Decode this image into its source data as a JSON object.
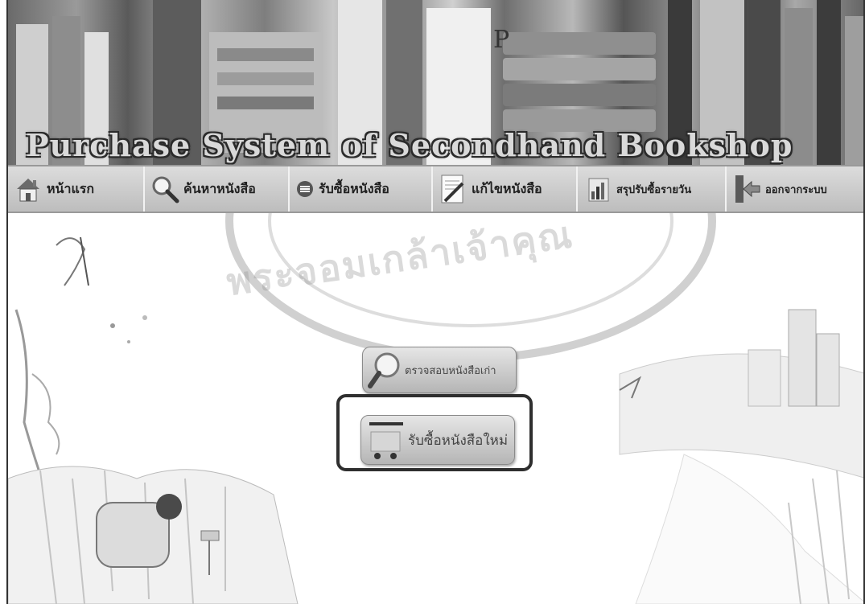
{
  "banner": {
    "title": "Purchase System of Secondhand Bookshop",
    "spine_mark": "P"
  },
  "nav": {
    "items": [
      {
        "label": "หน้าแรก",
        "icon": "house-icon"
      },
      {
        "label": "ค้นหาหนังสือ",
        "icon": "magnifier-icon"
      },
      {
        "label": "รับซื้อหนังสือ",
        "icon": "basket-icon"
      },
      {
        "label": "แก้ไขหนังสือ",
        "icon": "edit-document-icon"
      },
      {
        "label": "สรุปรับซื้อรายวัน",
        "icon": "report-chart-icon"
      },
      {
        "label": "ออกจากระบบ",
        "icon": "exit-door-icon"
      }
    ]
  },
  "main": {
    "check_button_label": "ตรวจสอบหนังสือเก่า",
    "new_purchase_button_label": "รับซื้อหนังสือใหม่"
  },
  "watermark": {
    "text": "พระจอมเกล้าเจ้าคุณ"
  },
  "colors": {
    "nav_bg": "#cfcfcf",
    "highlight_border": "#2f2f2f",
    "button_bg": "#c8c8c8"
  }
}
